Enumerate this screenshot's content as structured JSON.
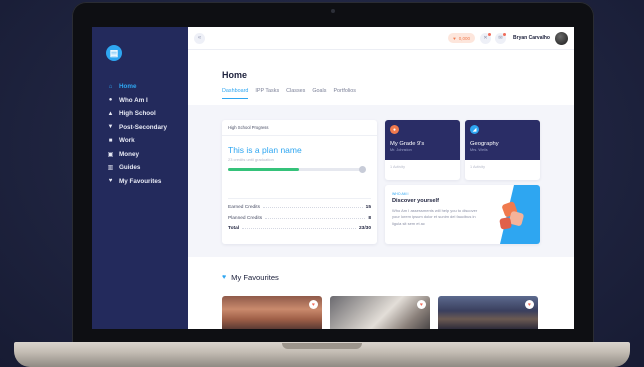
{
  "topbar": {
    "coins": "0,000",
    "user_name": "Bryan Carvalho"
  },
  "sidebar": {
    "items": [
      {
        "label": "Home",
        "icon": "home-icon",
        "glyph": "⌂",
        "active": true
      },
      {
        "label": "Who Am I",
        "icon": "person-icon",
        "glyph": "●",
        "active": false
      },
      {
        "label": "High School",
        "icon": "school-icon",
        "glyph": "▲",
        "active": false
      },
      {
        "label": "Post-Secondary",
        "icon": "graduation-icon",
        "glyph": "▼",
        "active": false
      },
      {
        "label": "Work",
        "icon": "briefcase-icon",
        "glyph": "■",
        "active": false
      },
      {
        "label": "Money",
        "icon": "money-icon",
        "glyph": "▣",
        "active": false
      },
      {
        "label": "Guides",
        "icon": "book-icon",
        "glyph": "▥",
        "active": false
      },
      {
        "label": "My Favourites",
        "icon": "heart-icon",
        "glyph": "♥",
        "active": false
      }
    ]
  },
  "main": {
    "title": "Home",
    "tabs": [
      {
        "label": "Dashboard",
        "active": true
      },
      {
        "label": "IPP Tasks",
        "active": false
      },
      {
        "label": "Classes",
        "active": false
      },
      {
        "label": "Goals",
        "active": false
      },
      {
        "label": "Portfolios",
        "active": false
      }
    ]
  },
  "progress": {
    "header": "High School Progress",
    "plan_name": "This is a plan name",
    "plan_sub": "23 credits until graduation",
    "fill_fraction": 0.52,
    "rows": [
      {
        "label": "Earned Credits",
        "value": "15"
      },
      {
        "label": "Planned Credits",
        "value": "8"
      },
      {
        "label": "Total",
        "value": "23/30"
      }
    ]
  },
  "classes": [
    {
      "name": "My Grade 9's",
      "teacher": "Mr. Johnston",
      "footer": "1 Activity",
      "icon_color": "#f07a4e"
    },
    {
      "name": "Geography",
      "teacher": "Mrs. Wells",
      "footer": "1 Activity",
      "icon_color": "#2ea6f1"
    }
  ],
  "discover": {
    "kicker": "WHO AM I",
    "title": "Discover yourself",
    "body": "Who Am I assessments will help you to discover your lorem ipsum dolor et sunim del faucibus in ligula sit sem et ac"
  },
  "favourites": {
    "title": "My Favourites"
  },
  "colors": {
    "accent": "#2ea6f1",
    "sidebar_bg": "#232a5c",
    "progress_green": "#35c27a",
    "class_card_bg": "#2a2d66"
  }
}
